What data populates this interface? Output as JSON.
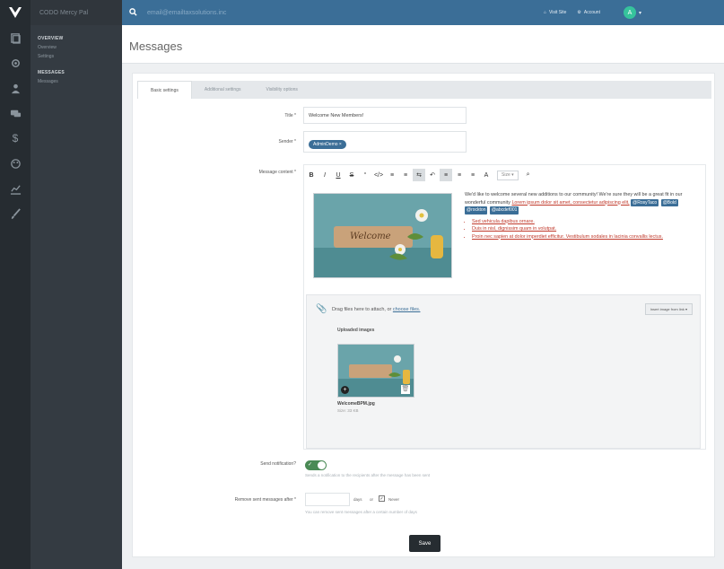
{
  "app": {
    "brand": "CODO Mercy Pal",
    "search_placeholder": "email@emailtaxsolutions.inc",
    "top_links": [
      {
        "icon": "house-icon",
        "label": "Visit Site"
      },
      {
        "icon": "gear-icon",
        "label": "Account"
      }
    ],
    "avatar_initial": "A"
  },
  "nav": {
    "sections": [
      {
        "title": "OVERVIEW",
        "items": [
          "Overview",
          "Settings"
        ]
      },
      {
        "title": "MESSAGES",
        "items": [
          "Messages"
        ]
      }
    ]
  },
  "page": {
    "title": "Messages"
  },
  "tabs": [
    "Basic settings",
    "Additional settings",
    "Visibility options"
  ],
  "form": {
    "title_label": "Title *",
    "title_value": "Welcome New Members!",
    "sender_label": "Sender *",
    "sender_tag": "AdminDemo ×",
    "content_label": "Message content *",
    "toolbar": [
      "B",
      "I",
      "U",
      "S",
      "“",
      "</>",
      "≡",
      "≡",
      "⇆",
      "↶",
      "≡",
      "≡",
      "≡",
      "A"
    ],
    "toolbar_select": "Size",
    "image_caption": "Welcome",
    "body": {
      "intro": "We'd like to welcome several new additions to our community! We're sure they will be a great fit in our wonderful community",
      "intro_red": "Lorem ipsum dolor sit amet, consectetur adipiscing elit,",
      "mentions": [
        "@RosyTaco",
        "@Bold",
        "@rockton",
        "@abcdef001"
      ],
      "bullets": [
        "Sed vehicula dapibus ornare.",
        "Duis in nisl, dignissim quam in volutpat.",
        "Proin nec sapien at dolor imperdiet efficitur. Vestibulum sodales in lacinia convallis lectus."
      ]
    },
    "upload": {
      "drop_text": "Drag files here to attach, or",
      "browse_link": "choose files.",
      "insert_button": "Insert image from link ▾",
      "uploaded_title": "Uploaded images",
      "file_name": "WelcomeBPM.jpg",
      "file_size": "Size: 33 KB"
    },
    "notify_label": "Send notification?",
    "notify_hint": "Sends a notification to the recipients after the message has been sent",
    "remove_label": "Remove sent messages after *",
    "remove_days_label": "days",
    "remove_or": "or",
    "remove_never": "Never",
    "remove_hint": "You can remove sent messages after a certain number of days",
    "save_label": "Save"
  }
}
